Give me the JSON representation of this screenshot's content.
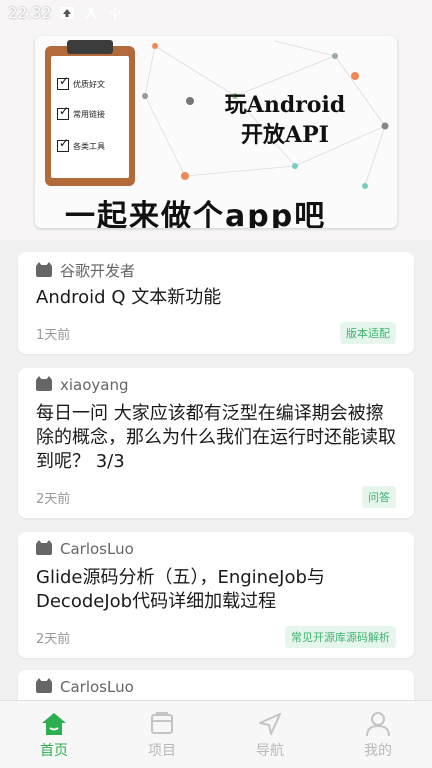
{
  "status_bar": {
    "time": "22:32"
  },
  "banner": {
    "checklist": [
      "优质好文",
      "常用链接",
      "各类工具"
    ],
    "title_line1": "玩Android",
    "title_line2": "开放API",
    "slogan": "一起来做个app吧"
  },
  "articles": [
    {
      "author": "谷歌开发者",
      "title": "Android Q 文本新功能",
      "time": "1天前",
      "tag": "版本适配"
    },
    {
      "author": "xiaoyang",
      "title": "每日一问 大家应该都有泛型在编译期会被擦除的概念，那么为什么我们在运行时还能读取到呢？ 3/3",
      "time": "2天前",
      "tag": "问答"
    },
    {
      "author": "CarlosLuo",
      "title": "Glide源码分析（五），EngineJob与DecodeJob代码详细加载过程",
      "time": "2天前",
      "tag": "常见开源库源码解析"
    },
    {
      "author": "CarlosLuo"
    }
  ],
  "nav": {
    "items": [
      {
        "label": "首页",
        "icon": "home-icon",
        "active": true
      },
      {
        "label": "项目",
        "icon": "project-icon",
        "active": false
      },
      {
        "label": "导航",
        "icon": "navigation-icon",
        "active": false
      },
      {
        "label": "我的",
        "icon": "user-icon",
        "active": false
      }
    ],
    "active_color": "#2eaf4f",
    "inactive_color": "#b9b9b9"
  }
}
